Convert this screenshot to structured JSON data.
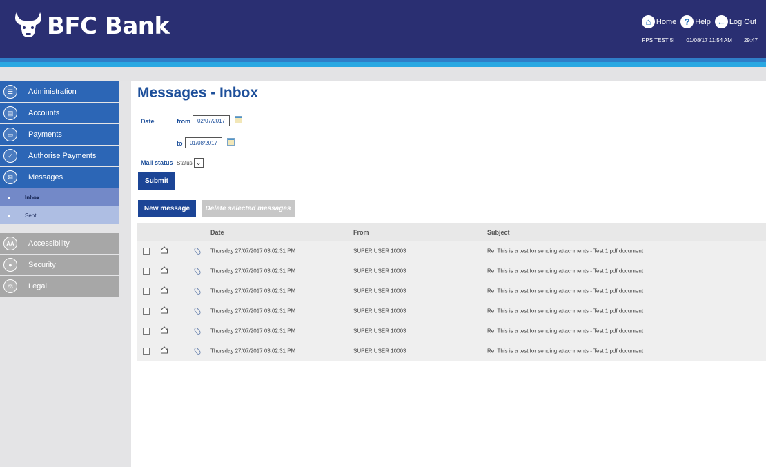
{
  "brand": {
    "name": "BFC Bank"
  },
  "top_nav": {
    "home": "Home",
    "help": "Help",
    "logout": "Log Out"
  },
  "session": {
    "user": "FPS TEST 5I",
    "datetime": "01/08/17 11:54 AM",
    "timer": "29:47"
  },
  "sidebar": {
    "items": [
      {
        "label": "Administration",
        "icon": "list-icon"
      },
      {
        "label": "Accounts",
        "icon": "document-icon"
      },
      {
        "label": "Payments",
        "icon": "payments-icon"
      },
      {
        "label": "Authorise Payments",
        "icon": "thumbs-up-icon"
      },
      {
        "label": "Messages",
        "icon": "envelope-icon"
      }
    ],
    "sub_items": [
      {
        "label": "Inbox"
      },
      {
        "label": "Sent"
      }
    ],
    "items2": [
      {
        "label": "Accessibility",
        "icon_text": "AA"
      },
      {
        "label": "Security",
        "icon": "lock-icon"
      },
      {
        "label": "Legal",
        "icon": "gavel-icon"
      }
    ]
  },
  "main": {
    "title": "Messages - Inbox",
    "filters": {
      "date_label": "Date",
      "from_label": "from",
      "from_value": "02/07/2017",
      "to_label": "to",
      "to_value": "01/08/2017",
      "mail_status_label": "Mail status",
      "status_value": "Status"
    },
    "buttons": {
      "submit": "Submit",
      "new_message": "New message",
      "delete_selected": "Delete selected messages"
    },
    "table": {
      "headers": {
        "date": "Date",
        "from": "From",
        "subject": "Subject"
      },
      "rows": [
        {
          "date": "Thursday 27/07/2017 03:02:31 PM",
          "from": "SUPER USER 10003",
          "subject": "Re: This is a test for sending attachments - Test 1 pdf document"
        },
        {
          "date": "Thursday 27/07/2017 03:02:31 PM",
          "from": "SUPER USER 10003",
          "subject": "Re: This is a test for sending attachments - Test 1 pdf document"
        },
        {
          "date": "Thursday 27/07/2017 03:02:31 PM",
          "from": "SUPER USER 10003",
          "subject": "Re: This is a test for sending attachments - Test 1 pdf document"
        },
        {
          "date": "Thursday 27/07/2017 03:02:31 PM",
          "from": "SUPER USER 10003",
          "subject": "Re: This is a test for sending attachments - Test 1 pdf document"
        },
        {
          "date": "Thursday 27/07/2017 03:02:31 PM",
          "from": "SUPER USER 10003",
          "subject": "Re: This is a test for sending attachments - Test 1 pdf document"
        },
        {
          "date": "Thursday 27/07/2017 03:02:31 PM",
          "from": "SUPER USER 10003",
          "subject": "Re: This is a test for sending attachments - Test 1 pdf document"
        }
      ]
    }
  },
  "colors": {
    "header_bg": "#2a2f72",
    "nav_blue": "#2c66b6",
    "nav_gray": "#a7a7a7",
    "title_blue": "#1d4f9a",
    "button_blue": "#1c4596"
  }
}
